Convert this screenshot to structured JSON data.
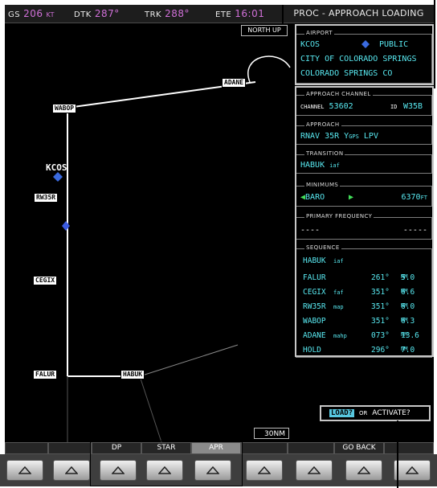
{
  "topbar": {
    "gs_label": "GS",
    "gs_value": "206",
    "gs_unit": "KT",
    "dtk_label": "DTK",
    "dtk_value": "287°",
    "trk_label": "TRK",
    "trk_value": "288°",
    "ete_label": "ETE",
    "ete_value": "16:01"
  },
  "page_title": "PROC - APPROACH LOADING",
  "map": {
    "orientation": "NORTH UP",
    "range": "30NM",
    "waypoints": [
      "ADANE",
      "WABOP",
      "RW35R",
      "CEGIX",
      "FALUR",
      "HABUK"
    ],
    "airport": "KCOS"
  },
  "airport": {
    "title": "AIRPORT",
    "ident": "KCOS",
    "type": "PUBLIC",
    "name": "CITY OF COLORADO SPRINGS",
    "city": "COLORADO SPRINGS CO"
  },
  "approach_channel": {
    "title": "APPROACH CHANNEL",
    "channel_label": "CHANNEL",
    "channel": "53602",
    "id_label": "ID",
    "id": "W35B"
  },
  "approach": {
    "title": "APPROACH",
    "name_main": "RNAV 35R Y",
    "name_gps": "GPS",
    "name_type": "LPV"
  },
  "transition": {
    "title": "TRANSITION",
    "name": "HABUK",
    "suffix": "iaf"
  },
  "minimums": {
    "title": "MINIMUMS",
    "type": "BARO",
    "value": "6370",
    "unit": "FT"
  },
  "primary_frequency": {
    "title": "PRIMARY FREQUENCY",
    "left": "----",
    "right": "-----"
  },
  "sequence": {
    "title": "SEQUENCE",
    "header": "HABUK",
    "header_suffix": "iaf",
    "rows": [
      {
        "wpt": "FALUR",
        "suffix": "",
        "crs": "261°",
        "dist": "5.0",
        "unit": "NM"
      },
      {
        "wpt": "CEGIX",
        "suffix": "faf",
        "crs": "351°",
        "dist": "6.6",
        "unit": "NM"
      },
      {
        "wpt": "RW35R",
        "suffix": "map",
        "crs": "351°",
        "dist": "6.0",
        "unit": "NM"
      },
      {
        "wpt": "WABOP",
        "suffix": "",
        "crs": "351°",
        "dist": "6.3",
        "unit": "NM"
      },
      {
        "wpt": "ADANE",
        "suffix": "mahp",
        "crs": "073°",
        "dist": "13.6",
        "unit": "NM"
      },
      {
        "wpt": "HOLD",
        "suffix": "",
        "crs": "296°",
        "dist": "7.0",
        "unit": "NM"
      }
    ]
  },
  "prompt": {
    "load": "LOAD?",
    "or": "OR",
    "activate": "ACTIVATE?"
  },
  "softkeys": [
    "",
    "",
    "DP",
    "STAR",
    "APR",
    "",
    "",
    "GO BACK",
    ""
  ],
  "colors": {
    "magenta": "#d070d8",
    "cyan": "#58e8f0",
    "green": "#42e05a"
  }
}
